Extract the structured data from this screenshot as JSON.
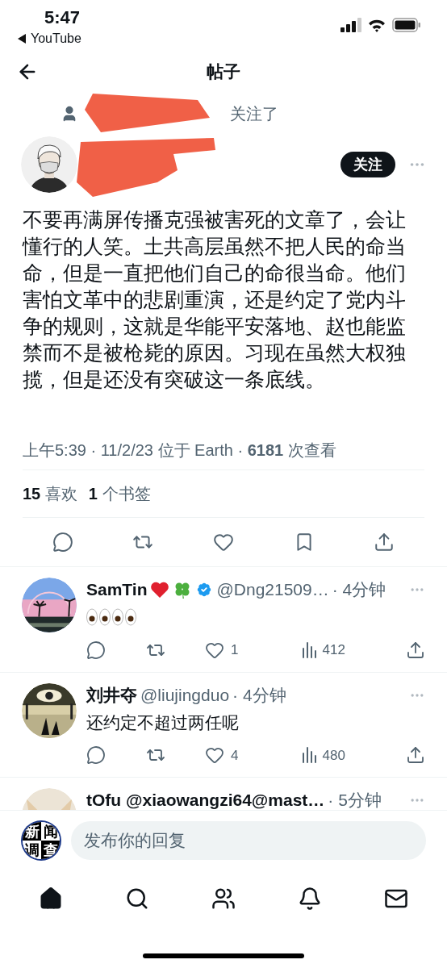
{
  "status_bar": {
    "time": "5:47",
    "back_label": "YouTube"
  },
  "header": {
    "title": "帖子"
  },
  "post": {
    "social_context": "关注了",
    "follow_button": "关注",
    "text": "不要再满屏传播克强被害死的文章了，会让懂行的人笑。土共高层虽然不把人民的命当命，但是一直把他们自己的命很当命。他们害怕文革中的悲剧重演，还是约定了党内斗争的规则，这就是华能平安落地、赵也能监禁而不是被枪毙的原因。习现在虽然大权独揽，但是还没有突破这一条底线。",
    "meta": "上午5:39 · 11/2/23 位于 Earth · **6181** 次查看",
    "counts": [
      {
        "count": "15",
        "label": "喜欢"
      },
      {
        "count": "1",
        "label": "个书签"
      }
    ],
    "actions": [
      {
        "kind": "reply"
      },
      {
        "kind": "repost"
      },
      {
        "kind": "like"
      },
      {
        "kind": "bookmark"
      },
      {
        "kind": "share"
      }
    ]
  },
  "replies": [
    {
      "name": "SamTin",
      "name_icons": [
        {
          "kind": "heart"
        },
        {
          "kind": "clover"
        }
      ],
      "verified": true,
      "handle": "@Dng21509…",
      "time": "· 4分钟",
      "content": {
        "kind": "eyes"
      },
      "likes": "1",
      "views": "412"
    },
    {
      "name": "刘井夺",
      "verified": false,
      "handle": "@liujingduo",
      "time": "· 4分钟",
      "content": {
        "kind": "text",
        "text": "还约定不超过两任呢"
      },
      "likes": "4",
      "views": "480"
    },
    {
      "name": "tOfu @xiaowangzi64@mast…",
      "verified": false,
      "time": "· 5分钟"
    }
  ],
  "compose": {
    "avatar_text": [
      "新",
      "闻",
      "调",
      "查"
    ],
    "placeholder": "发布你的回复"
  },
  "nav": [
    {
      "kind": "home",
      "selected": true
    },
    {
      "kind": "search",
      "selected": false
    },
    {
      "kind": "people",
      "selected": false
    },
    {
      "kind": "bell",
      "selected": false
    },
    {
      "kind": "mail",
      "selected": false
    }
  ]
}
